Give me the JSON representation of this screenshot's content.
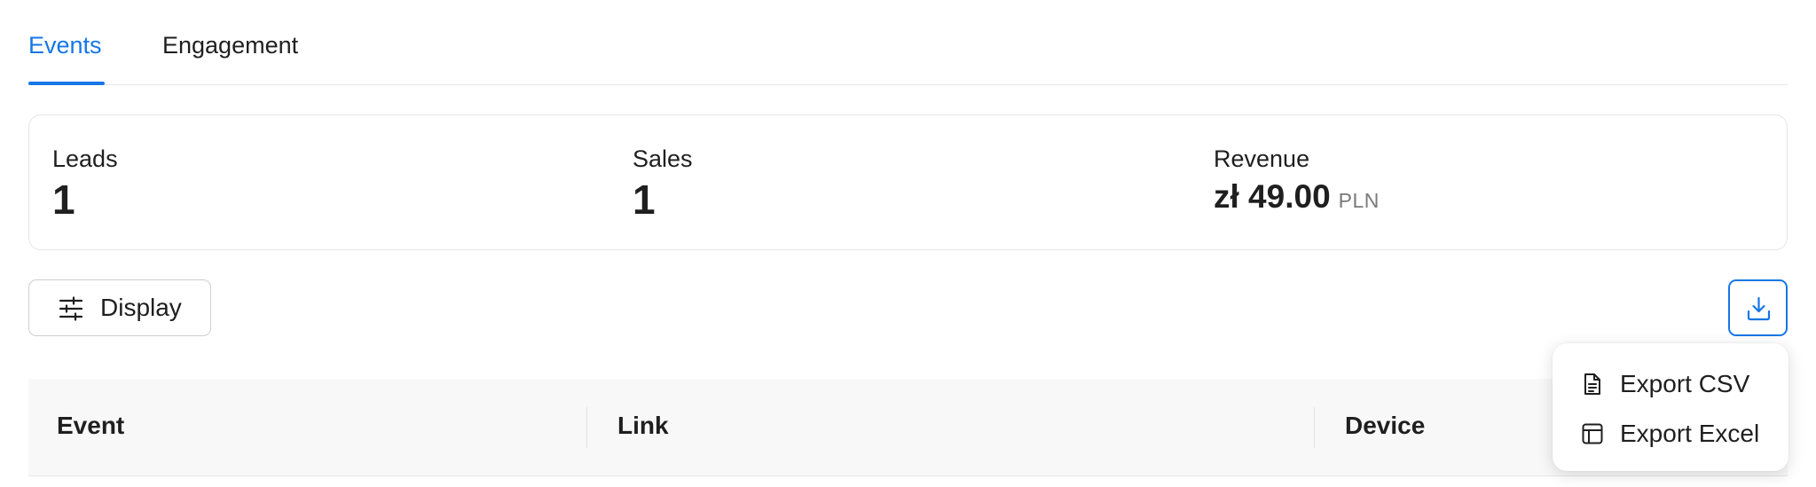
{
  "tabs": [
    {
      "label": "Events",
      "active": true
    },
    {
      "label": "Engagement",
      "active": false
    }
  ],
  "stats": {
    "leads": {
      "label": "Leads",
      "value": "1"
    },
    "sales": {
      "label": "Sales",
      "value": "1"
    },
    "revenue": {
      "label": "Revenue",
      "value": "zł 49.00",
      "currency": "PLN"
    }
  },
  "toolbar": {
    "display_label": "Display",
    "display_icon": "sliders-icon",
    "export_icon": "download-icon"
  },
  "table": {
    "columns": [
      "Event",
      "Link",
      "Device"
    ]
  },
  "export_menu": {
    "items": [
      {
        "label": "Export CSV",
        "icon": "file-text-icon"
      },
      {
        "label": "Export Excel",
        "icon": "spreadsheet-icon"
      }
    ]
  },
  "colors": {
    "accent": "#1677e6",
    "border": "#e6e6e6",
    "text": "#1f1f1f",
    "muted": "#7a7a7a"
  }
}
